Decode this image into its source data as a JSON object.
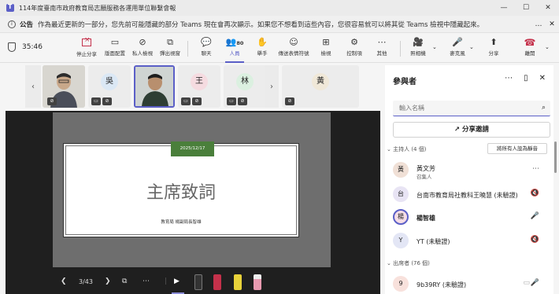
{
  "window": {
    "title": "114年度臺南市政府教育局志願服務各運用單位聯繫會報",
    "minimize": "—",
    "maximize": "☐",
    "close": "✕"
  },
  "notice": {
    "label": "公告",
    "text": "作為最近更新的一部分，您先前可能隱藏的部分 Teams 現在會再次顯示。如果您不想看到這些內容，您很容易就可以將其從 Teams 檢視中隱藏起來。",
    "more": "…",
    "close": "✕"
  },
  "toolbar": {
    "timer": "35:46",
    "buttons": [
      {
        "label": "停止分享",
        "icon": "stop-share"
      },
      {
        "label": "版面配置",
        "icon": "▭"
      },
      {
        "label": "私人檢視",
        "icon": "⊘"
      },
      {
        "label": "彈出視窗",
        "icon": "⧉"
      },
      {
        "label": "聊天",
        "icon": "💬"
      },
      {
        "label": "人員",
        "icon": "👥",
        "count": "80"
      },
      {
        "label": "舉手",
        "icon": "✋"
      },
      {
        "label": "傳送表情符號",
        "icon": "☺"
      },
      {
        "label": "檢視",
        "icon": "⊞"
      },
      {
        "label": "控制項",
        "icon": "⚙"
      },
      {
        "label": "其他",
        "icon": "⋯"
      },
      {
        "label": "照相機",
        "icon": "🎥"
      },
      {
        "label": "麥克風",
        "icon": "🎤"
      },
      {
        "label": "分享",
        "icon": "⬆"
      },
      {
        "label": "離開",
        "icon": "☎"
      }
    ]
  },
  "strip": {
    "tiles": [
      {
        "name": "video-participant-1",
        "initial": "",
        "kind": "video"
      },
      {
        "name": "participant-wu",
        "initial": "吳",
        "color": "#dbe8f5"
      },
      {
        "name": "video-participant-2",
        "initial": "",
        "kind": "video"
      },
      {
        "name": "participant-wang",
        "initial": "王",
        "color": "#f5dbe0"
      },
      {
        "name": "participant-lin",
        "initial": "林",
        "color": "#dbf0e0"
      },
      {
        "name": "participant-huang",
        "initial": "黃",
        "color": "#f0e8d8"
      }
    ]
  },
  "slide": {
    "date": "2025/12/17",
    "title": "主席致詞",
    "subtitle": "教育局 楊副局長智雄",
    "page": "3/43"
  },
  "panel": {
    "title": "參與者",
    "search_placeholder": "輸入名稱",
    "share_invite": "分享邀請",
    "hosts_header": "主持人 (4 個)",
    "mute_all": "將所有人設為靜音",
    "attendees_header": "出席者 (76 個)",
    "participants": [
      {
        "initial": "黃",
        "name": "黃文芳",
        "role": "召集人",
        "color": "#f0e0d6",
        "icon": "⋯"
      },
      {
        "initial": "台",
        "name": "台南市教育局社教科王曉慧 (未驗證)",
        "role": "",
        "color": "#e8e4f4",
        "icon": "🔇"
      },
      {
        "initial": "楊",
        "name": "楊智雄",
        "role": "",
        "color": "#f5dde6",
        "icon": "🎤"
      },
      {
        "initial": "Y",
        "name": "YT (未驗證)",
        "role": "",
        "color": "#e3e6f5",
        "icon": "🔇"
      },
      {
        "initial": "9",
        "name": "9b39RY (未驗證)",
        "role": "",
        "color": "#f8e1dc",
        "icon": "🎤"
      }
    ]
  }
}
